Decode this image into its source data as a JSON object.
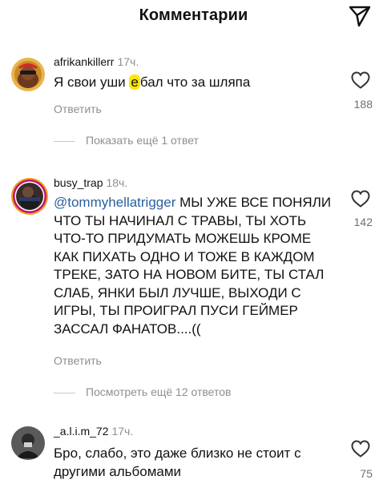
{
  "header": {
    "title": "Комментарии",
    "share_icon": "send-icon"
  },
  "comments": [
    {
      "username": "afrikankillerr",
      "time": "17ч.",
      "text_before": "Я свои уши ",
      "text_highlight": "е",
      "text_after": "бал что за шляпа",
      "reply_label": "Ответить",
      "likes": "188",
      "replies_toggle": "Показать ещё 1 ответ"
    },
    {
      "username": "busy_trap",
      "time": "18ч.",
      "mention": "@tommyhellatrigger",
      "text": " МЫ УЖЕ ВСЕ ПОНЯЛИ ЧТО ТЫ НАЧИНАЛ С ТРАВЫ, ТЫ ХОТЬ ЧТО-ТО ПРИДУМАТЬ МОЖЕШЬ КРОМЕ КАК ПИХАТЬ ОДНО И ТОЖЕ В КАЖДОМ ТРЕКЕ, ЗАТО НА НОВОМ БИТЕ, ТЫ СТАЛ СЛАБ, ЯНКИ БЫЛ ЛУЧШЕ, ВЫХОДИ С ИГРЫ, ТЫ ПРОИГРАЛ ПУСИ ГЕЙМЕР ЗАССАЛ ФАНАТОВ....((",
      "reply_label": "Ответить",
      "likes": "142",
      "replies_toggle": "Посмотреть ещё 12 ответов"
    },
    {
      "username": "_a.l.i.m_72",
      "time": "17ч.",
      "text": "Бро, слабо, это даже близко не стоит с другими альбомами",
      "likes": "75"
    }
  ],
  "colors": {
    "text": "#111111",
    "muted": "#8e8e8e",
    "mention": "#2b5f9e",
    "highlight": "#ffe600"
  }
}
